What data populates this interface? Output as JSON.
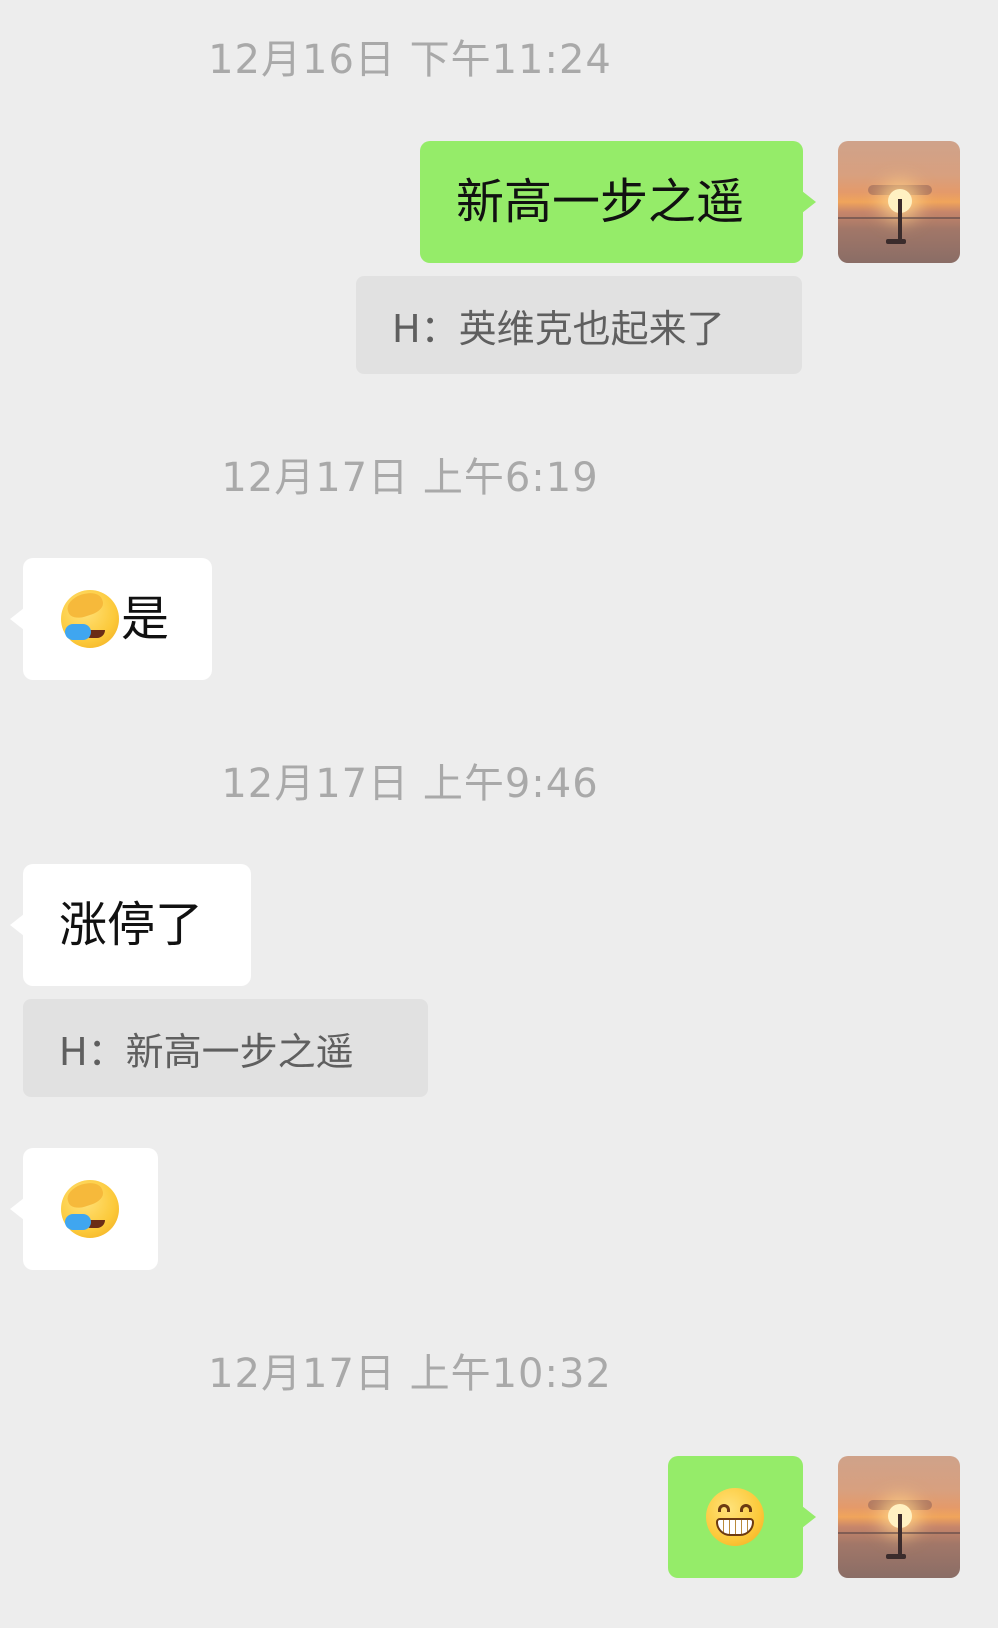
{
  "chat": {
    "timestamps": [
      "12月16日 下午11:24",
      "12月17日 上午6:19",
      "12月17日 上午9:46",
      "12月17日 上午10:32"
    ],
    "messages": [
      {
        "side": "right",
        "text": "新高一步之遥"
      },
      {
        "side": "right",
        "quote": "H：英维克也起来了"
      },
      {
        "side": "left",
        "emoji": "facepalm-crying-emoji",
        "text": "是"
      },
      {
        "side": "left",
        "text": "涨停了"
      },
      {
        "side": "left",
        "quote": "H：新高一步之遥"
      },
      {
        "side": "left",
        "emoji": "facepalm-crying-emoji"
      },
      {
        "side": "right",
        "emoji": "grinning-teeth-emoji"
      }
    ]
  },
  "colors": {
    "background": "#ededed",
    "sent_bubble": "#95ec69",
    "received_bubble": "#ffffff",
    "quote_bubble": "#e1e1e1",
    "timestamp_text": "#a9a9a9"
  }
}
